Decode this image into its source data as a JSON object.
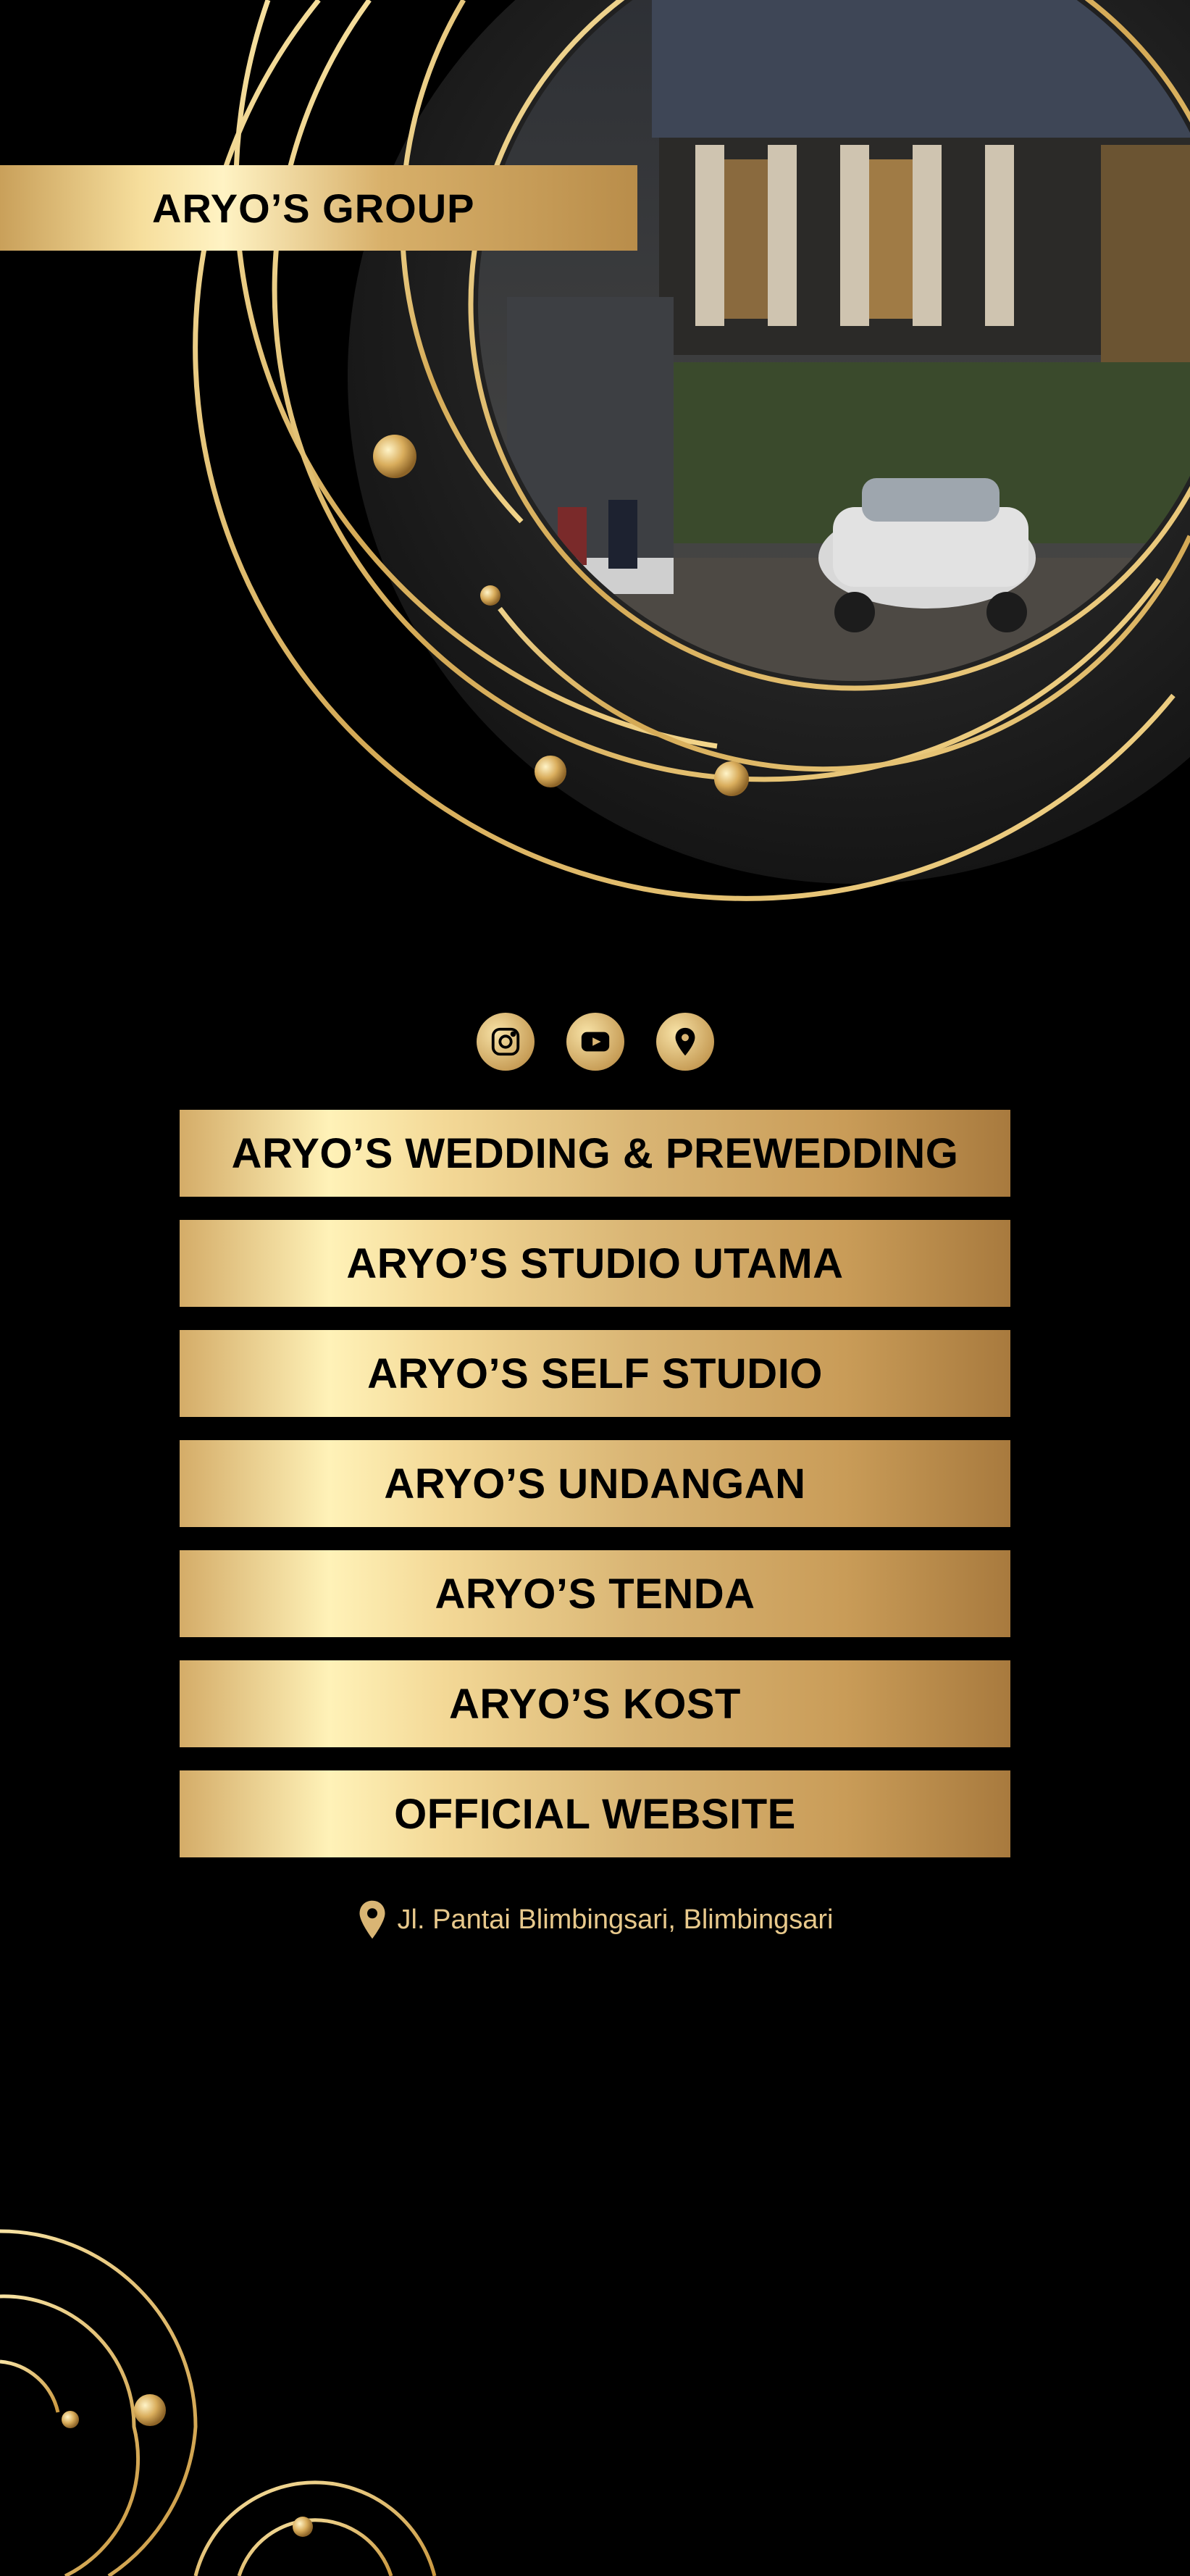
{
  "brand": {
    "title": "ARYO’S GROUP"
  },
  "socials": [
    {
      "icon": "instagram-icon"
    },
    {
      "icon": "youtube-icon"
    },
    {
      "icon": "map-pin-icon"
    }
  ],
  "links": [
    {
      "label": "ARYO’S WEDDING & PREWEDDING"
    },
    {
      "label": "ARYO’S STUDIO UTAMA"
    },
    {
      "label": "ARYO’S SELF STUDIO"
    },
    {
      "label": "ARYO’S UNDANGAN"
    },
    {
      "label": "ARYO’S TENDA"
    },
    {
      "label": "ARYO’S KOST"
    },
    {
      "label": "OFFICIAL WEBSITE"
    }
  ],
  "address": {
    "text": "Jl. Pantai Blimbingsari, Blimbingsari"
  },
  "colors": {
    "background": "#000000",
    "gold": "#d9b574",
    "gold_light": "#fff2b8",
    "gold_dark": "#a87a3e"
  }
}
